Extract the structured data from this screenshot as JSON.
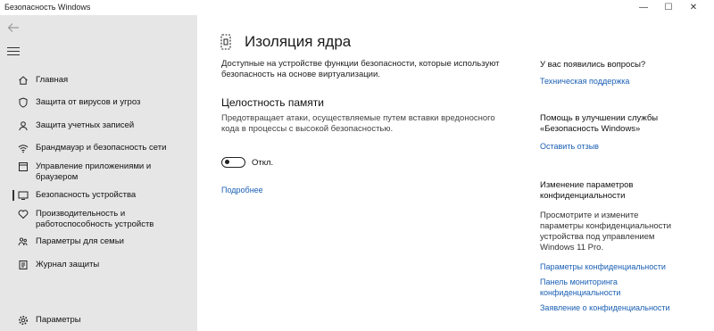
{
  "window": {
    "title": "Безопасность Windows",
    "minimize": "—",
    "maximize": "☐",
    "close": "✕"
  },
  "sidebar": {
    "back_icon": "back-arrow-icon",
    "menu_icon": "hamburger-icon",
    "items": [
      {
        "label": "Главная",
        "icon": "home-icon"
      },
      {
        "label": "Защита от вирусов и угроз",
        "icon": "shield-icon"
      },
      {
        "label": "Защита учетных записей",
        "icon": "person-icon"
      },
      {
        "label": "Брандмауэр и безопасность сети",
        "icon": "wifi-icon"
      },
      {
        "label": "Управление приложениями и браузером",
        "icon": "app-browser-icon"
      },
      {
        "label": "Безопасность устройства",
        "icon": "device-icon"
      },
      {
        "label": "Производительность и работоспособность устройств",
        "icon": "heart-icon"
      },
      {
        "label": "Параметры для семьи",
        "icon": "family-icon"
      },
      {
        "label": "Журнал защиты",
        "icon": "history-icon"
      }
    ],
    "settings_label": "Параметры"
  },
  "main": {
    "title": "Изоляция ядра",
    "description": "Доступные на устройстве функции безопасности, которые используют безопасность на основе виртуализации.",
    "section_title": "Целостность памяти",
    "section_description": "Предотвращает атаки, осуществляемые путем вставки вредоносного кода в процессы с высокой безопасностью.",
    "toggle_state": "Откл.",
    "more_link": "Подробнее"
  },
  "side": {
    "questions_heading": "У вас появились вопросы?",
    "support_link": "Техническая поддержка",
    "improve_heading": "Помощь в улучшении службы «Безопасность Windows»",
    "feedback_link": "Оставить отзыв",
    "privacy_heading": "Изменение параметров конфиденциальности",
    "privacy_text": "Просмотрите и измените параметры конфиденциальности устройства под управлением Windows 11 Pro.",
    "privacy_settings_link": "Параметры конфиденциальности",
    "privacy_dashboard_link": "Панель мониторинга конфиденциальности",
    "privacy_statement_link": "Заявление о конфиденциальности"
  }
}
